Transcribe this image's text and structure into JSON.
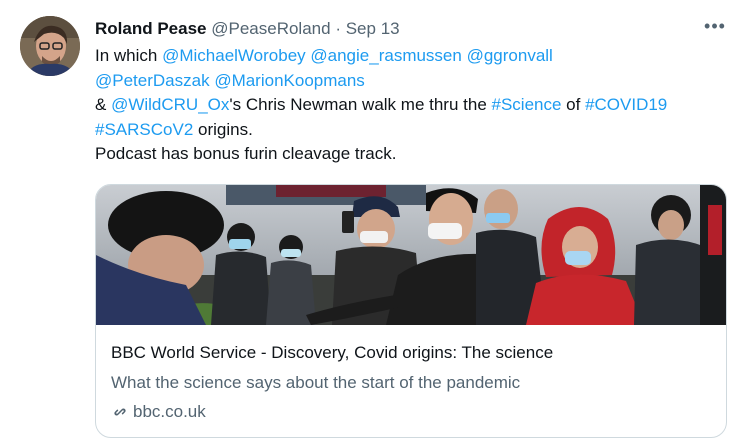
{
  "tweet": {
    "author_name": "Roland Pease",
    "author_handle": "@PeaseRoland",
    "separator": "·",
    "date": "Sep 13",
    "more_label": "•••",
    "line1_prefix": "In which ",
    "mention1": "@MichaelWorobey",
    "mention2": "@angie_rasmussen",
    "mention3": "@ggronvall",
    "mention4": "@PeterDaszak",
    "mention5": "@MarionKoopmans",
    "amp": "& ",
    "mention6": "@WildCRU_Ox",
    "line3_mid": "'s Chris Newman walk me thru the ",
    "hashtag1": "#Science",
    "of": " of ",
    "hashtag2": "#COVID19",
    "hashtag3": "#SARSCoV2",
    "line4_rest": " origins.",
    "line5": "Podcast has bonus furin cleavage track."
  },
  "card": {
    "title": "BBC World Service - Discovery, Covid origins: The science",
    "description": "What the science says about the start of the pandemic",
    "domain": "bbc.co.uk",
    "domain_icon": "link-icon"
  },
  "colors": {
    "link": "#1d9bf0",
    "muted": "#536471",
    "border": "#cfd9de"
  }
}
